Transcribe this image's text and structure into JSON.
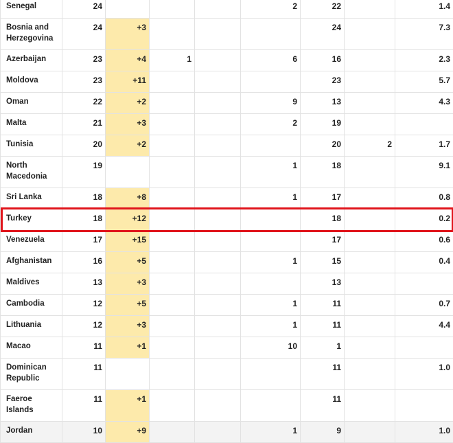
{
  "rows": [
    {
      "country": "Senegal",
      "cells": [
        "24",
        "",
        "",
        "",
        "2",
        "22",
        "",
        "1.4"
      ]
    },
    {
      "country": "Bosnia and Herzegovina",
      "cells": [
        "24",
        "+3",
        "",
        "",
        "",
        "24",
        "",
        "7.3"
      ]
    },
    {
      "country": "Azerbaijan",
      "cells": [
        "23",
        "+4",
        "1",
        "",
        "6",
        "16",
        "",
        "2.3"
      ]
    },
    {
      "country": "Moldova",
      "cells": [
        "23",
        "+11",
        "",
        "",
        "",
        "23",
        "",
        "5.7"
      ]
    },
    {
      "country": "Oman",
      "cells": [
        "22",
        "+2",
        "",
        "",
        "9",
        "13",
        "",
        "4.3"
      ]
    },
    {
      "country": "Malta",
      "cells": [
        "21",
        "+3",
        "",
        "",
        "2",
        "19",
        "",
        ""
      ]
    },
    {
      "country": "Tunisia",
      "cells": [
        "20",
        "+2",
        "",
        "",
        "",
        "20",
        "2",
        "1.7"
      ]
    },
    {
      "country": "North Macedonia",
      "cells": [
        "19",
        "",
        "",
        "",
        "1",
        "18",
        "",
        "9.1"
      ]
    },
    {
      "country": "Sri Lanka",
      "cells": [
        "18",
        "+8",
        "",
        "",
        "1",
        "17",
        "",
        "0.8"
      ]
    },
    {
      "country": "Turkey",
      "cells": [
        "18",
        "+12",
        "",
        "",
        "",
        "18",
        "",
        "0.2"
      ]
    },
    {
      "country": "Venezuela",
      "cells": [
        "17",
        "+15",
        "",
        "",
        "",
        "17",
        "",
        "0.6"
      ]
    },
    {
      "country": "Afghanistan",
      "cells": [
        "16",
        "+5",
        "",
        "",
        "1",
        "15",
        "",
        "0.4"
      ]
    },
    {
      "country": "Maldives",
      "cells": [
        "13",
        "+3",
        "",
        "",
        "",
        "13",
        "",
        ""
      ]
    },
    {
      "country": "Cambodia",
      "cells": [
        "12",
        "+5",
        "",
        "",
        "1",
        "11",
        "",
        "0.7"
      ]
    },
    {
      "country": "Lithuania",
      "cells": [
        "12",
        "+3",
        "",
        "",
        "1",
        "11",
        "",
        "4.4"
      ]
    },
    {
      "country": "Macao",
      "cells": [
        "11",
        "+1",
        "",
        "",
        "10",
        "1",
        "",
        ""
      ]
    },
    {
      "country": "Dominican Republic",
      "cells": [
        "11",
        "",
        "",
        "",
        "",
        "11",
        "",
        "1.0"
      ]
    },
    {
      "country": "Faeroe Islands",
      "cells": [
        "11",
        "+1",
        "",
        "",
        "",
        "11",
        "",
        ""
      ]
    },
    {
      "country": "Jordan",
      "cells": [
        "10",
        "+9",
        "",
        "",
        "1",
        "9",
        "",
        "1.0"
      ]
    }
  ],
  "highlighted_country": "Turkey",
  "colors": {
    "new_cases_fill": "#fdeaab",
    "highlight_border": "#e0141b",
    "grid_line": "#e2e2e2"
  }
}
